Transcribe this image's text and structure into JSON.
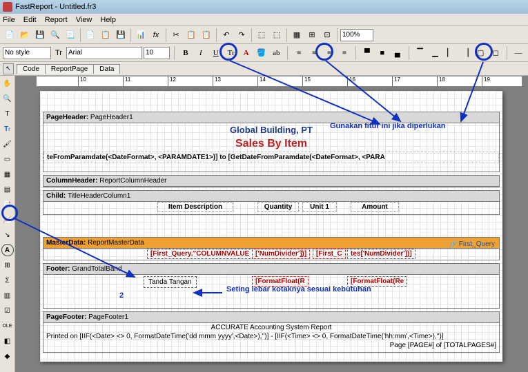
{
  "window": {
    "title": "FastReport - Untitled.fr3"
  },
  "menu": [
    "File",
    "Edit",
    "Report",
    "View",
    "Help"
  ],
  "toolbar": {
    "zoom": "100%"
  },
  "format": {
    "style": "No style",
    "font": "Arial",
    "size": "10"
  },
  "tabs": [
    "Code",
    "ReportPage",
    "Data"
  ],
  "ruler_ticks": [
    "10",
    "11",
    "12",
    "13",
    "14",
    "15",
    "16",
    "17",
    "18",
    "19"
  ],
  "bands": {
    "page_header": {
      "label": "PageHeader:",
      "name": "PageHeader1"
    },
    "column_header": {
      "label": "ColumnHeader:",
      "name": "ReportColumnHeader"
    },
    "child": {
      "label": "Child:",
      "name": "TitleHeaderColumn1"
    },
    "master": {
      "label": "MasterData:",
      "name": "ReportMasterData",
      "link": "First_Query"
    },
    "footer": {
      "label": "Footer:",
      "name": "GrandTotalBand"
    },
    "page_footer": {
      "label": "PageFooter:",
      "name": "PageFooter1"
    }
  },
  "report": {
    "company": "Global Building, PT",
    "title": "Sales By Item",
    "date_expr": "teFromParamdate(<DateFormat>, <PARAMDATE1>)] to [GetDateFromParamdate(<DateFormat>, <PARA",
    "columns": [
      "Item Description",
      "Quantity",
      "Unit 1",
      "Amount"
    ],
    "master_fields": [
      "[First_Query.\"COLUMNVALUE",
      "['NumDivider'])]",
      "[First_C",
      "tes['NumDivider'])]"
    ],
    "footer_fields": [
      "[FormatFloat(R",
      "[FormatFloat(Re"
    ],
    "sign_label": "Tanda Tangan",
    "sign_num": "2",
    "acc_line": "ACCURATE Accounting System Report",
    "print_line": "Printed on [IIF(<Date> <> 0, FormatDateTime('dd mmm yyyy',<Date>),'')] - [IIF(<Time> <> 0, FormatDateTime('hh:mm',<Time>),'')]",
    "page_line": "Page [PAGE#] of [TOTALPAGES#]"
  },
  "annotations": {
    "top": "Gunakan fitur ini jika diperlukan",
    "bottom": "Seting lebar kotaknya sesuai kebutuhan"
  }
}
